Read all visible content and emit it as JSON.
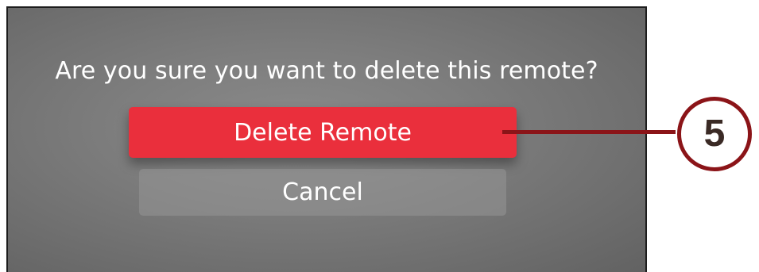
{
  "dialog": {
    "prompt": "Are you sure you want to delete this remote?",
    "delete_label": "Delete Remote",
    "cancel_label": "Cancel"
  },
  "callout": {
    "number": "5"
  },
  "colors": {
    "delete_button": "#ea2f3c",
    "callout": "#8b1418",
    "screen_background": "#7a7a7a"
  }
}
